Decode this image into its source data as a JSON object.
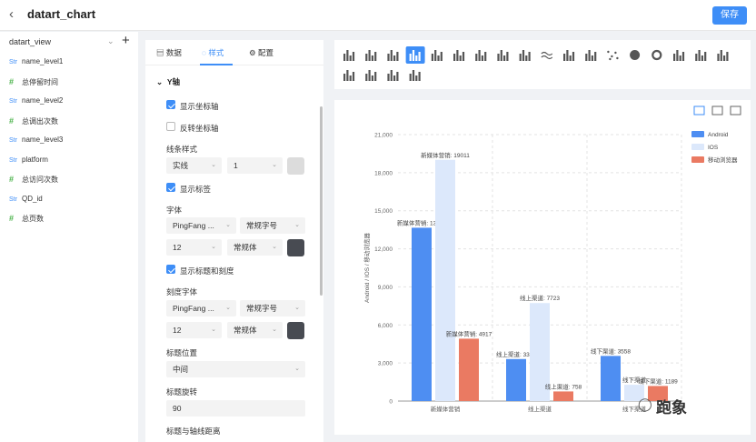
{
  "header": {
    "back_icon": "chevron-left-icon",
    "title": "datart_chart",
    "save_label": "保存"
  },
  "left_panel": {
    "view_name": "datart_view",
    "fields": [
      {
        "type_label": "Str",
        "kind": "string",
        "name": "name_level1"
      },
      {
        "type_label": "#",
        "kind": "number",
        "name": "总停留时间"
      },
      {
        "type_label": "Str",
        "kind": "string",
        "name": "name_level2"
      },
      {
        "type_label": "#",
        "kind": "number",
        "name": "总调出次数"
      },
      {
        "type_label": "Str",
        "kind": "string",
        "name": "name_level3"
      },
      {
        "type_label": "Str",
        "kind": "string",
        "name": "platform"
      },
      {
        "type_label": "#",
        "kind": "number",
        "name": "总访问次数"
      },
      {
        "type_label": "Str",
        "kind": "string",
        "name": "QD_id"
      },
      {
        "type_label": "#",
        "kind": "number",
        "name": "总页数"
      }
    ]
  },
  "config_panel": {
    "tabs": [
      {
        "label": "数据",
        "icon": "file-icon"
      },
      {
        "label": "样式",
        "icon": "palette-icon",
        "active": true
      },
      {
        "label": "配置",
        "icon": "gear-icon"
      }
    ],
    "section_title": "Y轴",
    "show_axis": "显示坐标轴",
    "reverse_axis": "反转坐标轴",
    "line_style_label": "线条样式",
    "line_style_value": "实线",
    "line_width_value": "1",
    "show_label": "显示标签",
    "font_label": "字体",
    "font_family": "PingFang ...",
    "font_size_name": "常规字号",
    "font_size": "12",
    "font_weight": "常规体",
    "show_title_ticks": "显示标题和刻度",
    "tick_font_label": "刻度字体",
    "tick_font_family": "PingFang ...",
    "tick_font_size_name": "常规字号",
    "tick_font_size": "12",
    "tick_font_weight": "常规体",
    "title_pos_label": "标题位置",
    "title_pos_value": "中间",
    "title_rotate_label": "标题旋转",
    "title_rotate_value": "90",
    "title_gap_label": "标题与轴线距离",
    "colors": {
      "swatch_light": "#dcdcdc",
      "swatch_dark": "#484b52",
      "accent": "#3e8ef7"
    }
  },
  "chart_types": [
    "table-icon",
    "pivot-table-icon",
    "grid-icon",
    "bar-chart-icon",
    "horizontal-bar-icon",
    "grouped-bar-icon",
    "stacked-horizontal-bar-icon",
    "stacked-bar-icon",
    "percent-bar-icon",
    "wave-icon",
    "area-chart-icon",
    "stacked-area-icon",
    "scatter-icon",
    "pie-icon",
    "donut-icon",
    "rose-icon",
    "funnel-icon",
    "signal-icon",
    "gauge-icon",
    "map-icon",
    "map-scatter-icon",
    "combo-chart-icon"
  ],
  "chart_toolbar": [
    "line-chart-icon",
    "table-view-icon",
    "monitor-icon"
  ],
  "chart_data": {
    "type": "bar",
    "categories": [
      "新媒体营销",
      "线上渠道",
      "线下渠道"
    ],
    "series": [
      {
        "name": "Android",
        "values": [
          13661,
          3313,
          3558
        ],
        "labels": [
          "新媒体营销: 13661",
          "线上渠道: 3313",
          "线下渠道: 3558"
        ],
        "color": "#4e8ef2"
      },
      {
        "name": "IOS",
        "values": [
          19011,
          7723,
          1280
        ],
        "labels": [
          "新媒体营销: 19011",
          "线上渠道: 7723",
          "线下渠道"
        ],
        "color": "#dce8fb"
      },
      {
        "name": "移动浏览器",
        "values": [
          4917,
          758,
          1189
        ],
        "labels": [
          "新媒体营销: 4917",
          "线上渠道: 758",
          "线下渠道: 1189"
        ],
        "color": "#ea7a62"
      }
    ],
    "ylabel": "Android / IOS / 移动浏览器",
    "yticks": [
      "0",
      "3,000",
      "6,000",
      "9,000",
      "12,000",
      "15,000",
      "18,000",
      "21,000"
    ],
    "ylim": [
      0,
      21000
    ],
    "grid": true,
    "legend_position": "top-right"
  },
  "watermark": {
    "icon": "wechat-icon",
    "text": "跑象"
  }
}
